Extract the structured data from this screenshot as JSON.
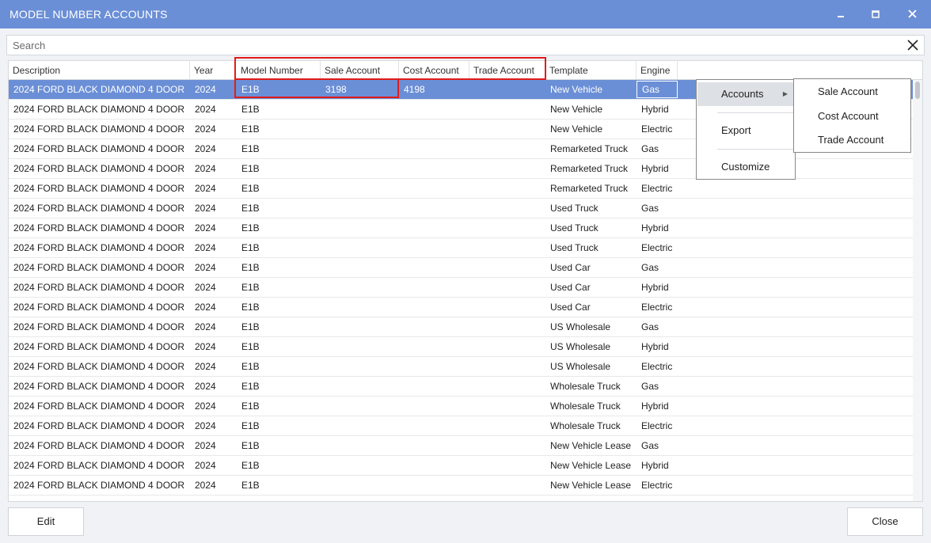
{
  "window": {
    "title": "MODEL NUMBER ACCOUNTS",
    "minimize_glyph": "▬",
    "maximize_glyph": "◼",
    "close_glyph": "✕"
  },
  "search": {
    "placeholder": "Search",
    "value": "",
    "clear_glyph": "✕"
  },
  "columns": {
    "description": "Description",
    "year": "Year",
    "model_number": "Model Number",
    "sale_account": "Sale Account",
    "cost_account": "Cost Account",
    "trade_account": "Trade Account",
    "template": "Template",
    "engine": "Engine"
  },
  "rows": [
    {
      "description": "2024 FORD BLACK DIAMOND 4 DOOR",
      "year": "2024",
      "model_number": "E1B",
      "sale_account": "3198",
      "cost_account": "4198",
      "trade_account": "",
      "template": "New Vehicle",
      "engine": "Gas",
      "selected": true
    },
    {
      "description": "2024 FORD BLACK DIAMOND 4 DOOR",
      "year": "2024",
      "model_number": "E1B",
      "sale_account": "",
      "cost_account": "",
      "trade_account": "",
      "template": "New Vehicle",
      "engine": "Hybrid"
    },
    {
      "description": "2024 FORD BLACK DIAMOND 4 DOOR",
      "year": "2024",
      "model_number": "E1B",
      "sale_account": "",
      "cost_account": "",
      "trade_account": "",
      "template": "New Vehicle",
      "engine": "Electric"
    },
    {
      "description": "2024 FORD BLACK DIAMOND 4 DOOR",
      "year": "2024",
      "model_number": "E1B",
      "sale_account": "",
      "cost_account": "",
      "trade_account": "",
      "template": "Remarketed Truck",
      "engine": "Gas"
    },
    {
      "description": "2024 FORD BLACK DIAMOND 4 DOOR",
      "year": "2024",
      "model_number": "E1B",
      "sale_account": "",
      "cost_account": "",
      "trade_account": "",
      "template": "Remarketed Truck",
      "engine": "Hybrid"
    },
    {
      "description": "2024 FORD BLACK DIAMOND 4 DOOR",
      "year": "2024",
      "model_number": "E1B",
      "sale_account": "",
      "cost_account": "",
      "trade_account": "",
      "template": "Remarketed Truck",
      "engine": "Electric"
    },
    {
      "description": "2024 FORD BLACK DIAMOND 4 DOOR",
      "year": "2024",
      "model_number": "E1B",
      "sale_account": "",
      "cost_account": "",
      "trade_account": "",
      "template": "Used Truck",
      "engine": "Gas"
    },
    {
      "description": "2024 FORD BLACK DIAMOND 4 DOOR",
      "year": "2024",
      "model_number": "E1B",
      "sale_account": "",
      "cost_account": "",
      "trade_account": "",
      "template": "Used Truck",
      "engine": "Hybrid"
    },
    {
      "description": "2024 FORD BLACK DIAMOND 4 DOOR",
      "year": "2024",
      "model_number": "E1B",
      "sale_account": "",
      "cost_account": "",
      "trade_account": "",
      "template": "Used Truck",
      "engine": "Electric"
    },
    {
      "description": "2024 FORD BLACK DIAMOND 4 DOOR",
      "year": "2024",
      "model_number": "E1B",
      "sale_account": "",
      "cost_account": "",
      "trade_account": "",
      "template": "Used Car",
      "engine": "Gas"
    },
    {
      "description": "2024 FORD BLACK DIAMOND 4 DOOR",
      "year": "2024",
      "model_number": "E1B",
      "sale_account": "",
      "cost_account": "",
      "trade_account": "",
      "template": "Used Car",
      "engine": "Hybrid"
    },
    {
      "description": "2024 FORD BLACK DIAMOND 4 DOOR",
      "year": "2024",
      "model_number": "E1B",
      "sale_account": "",
      "cost_account": "",
      "trade_account": "",
      "template": "Used Car",
      "engine": "Electric"
    },
    {
      "description": "2024 FORD BLACK DIAMOND 4 DOOR",
      "year": "2024",
      "model_number": "E1B",
      "sale_account": "",
      "cost_account": "",
      "trade_account": "",
      "template": "US Wholesale",
      "engine": "Gas"
    },
    {
      "description": "2024 FORD BLACK DIAMOND 4 DOOR",
      "year": "2024",
      "model_number": "E1B",
      "sale_account": "",
      "cost_account": "",
      "trade_account": "",
      "template": "US Wholesale",
      "engine": "Hybrid"
    },
    {
      "description": "2024 FORD BLACK DIAMOND 4 DOOR",
      "year": "2024",
      "model_number": "E1B",
      "sale_account": "",
      "cost_account": "",
      "trade_account": "",
      "template": "US Wholesale",
      "engine": "Electric"
    },
    {
      "description": "2024 FORD BLACK DIAMOND 4 DOOR",
      "year": "2024",
      "model_number": "E1B",
      "sale_account": "",
      "cost_account": "",
      "trade_account": "",
      "template": "Wholesale Truck",
      "engine": "Gas"
    },
    {
      "description": "2024 FORD BLACK DIAMOND 4 DOOR",
      "year": "2024",
      "model_number": "E1B",
      "sale_account": "",
      "cost_account": "",
      "trade_account": "",
      "template": "Wholesale Truck",
      "engine": "Hybrid"
    },
    {
      "description": "2024 FORD BLACK DIAMOND 4 DOOR",
      "year": "2024",
      "model_number": "E1B",
      "sale_account": "",
      "cost_account": "",
      "trade_account": "",
      "template": "Wholesale Truck",
      "engine": "Electric"
    },
    {
      "description": "2024 FORD BLACK DIAMOND 4 DOOR",
      "year": "2024",
      "model_number": "E1B",
      "sale_account": "",
      "cost_account": "",
      "trade_account": "",
      "template": "New Vehicle Lease",
      "engine": "Gas"
    },
    {
      "description": "2024 FORD BLACK DIAMOND 4 DOOR",
      "year": "2024",
      "model_number": "E1B",
      "sale_account": "",
      "cost_account": "",
      "trade_account": "",
      "template": "New Vehicle Lease",
      "engine": "Hybrid"
    },
    {
      "description": "2024 FORD BLACK DIAMOND 4 DOOR",
      "year": "2024",
      "model_number": "E1B",
      "sale_account": "",
      "cost_account": "",
      "trade_account": "",
      "template": "New Vehicle Lease",
      "engine": "Electric"
    }
  ],
  "context_menu": {
    "items": [
      {
        "label": "Accounts",
        "has_submenu": true,
        "active": true
      },
      {
        "label": "Export"
      },
      {
        "label": "Customize"
      }
    ],
    "submenu_arrow": "▶",
    "submenu": [
      "Sale Account",
      "Cost Account",
      "Trade Account"
    ]
  },
  "buttons": {
    "edit": "Edit",
    "close": "Close"
  },
  "colors": {
    "title_bar": "#6b8fd6",
    "selected_row": "#6b8fd6",
    "highlight_box": "#e21b1b"
  }
}
